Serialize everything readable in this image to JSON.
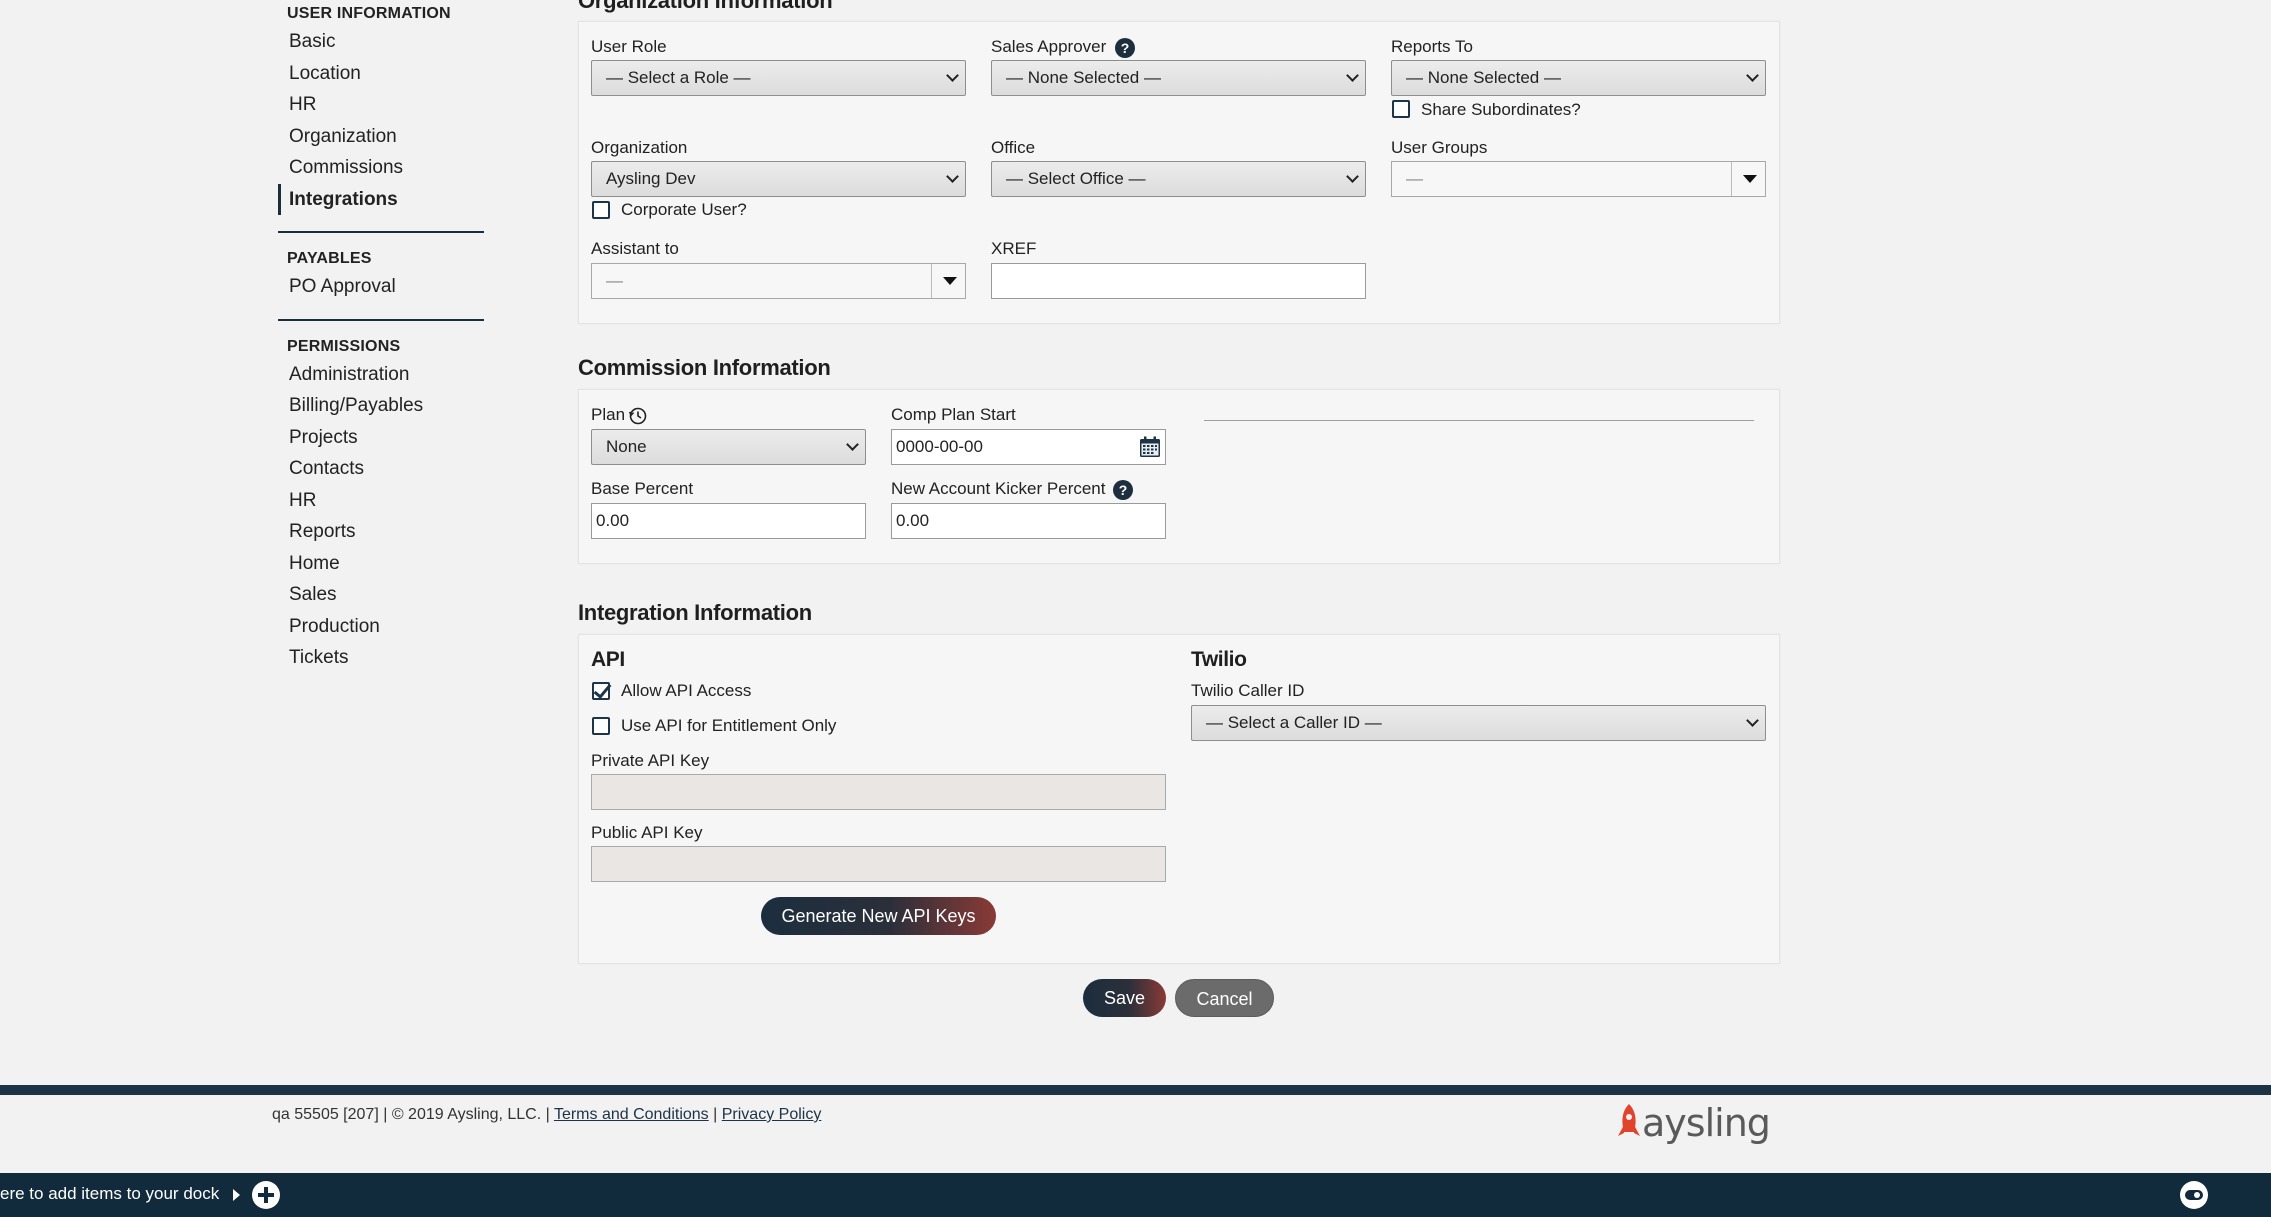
{
  "sidebar": {
    "groups": [
      {
        "title": "USER INFORMATION",
        "items": [
          "Basic",
          "Location",
          "HR",
          "Organization",
          "Commissions",
          "Integrations"
        ]
      },
      {
        "title": "PAYABLES",
        "items": [
          "PO Approval"
        ]
      },
      {
        "title": "PERMISSIONS",
        "items": [
          "Administration",
          "Billing/Payables",
          "Projects",
          "Contacts",
          "HR",
          "Reports",
          "Home",
          "Sales",
          "Production",
          "Tickets"
        ]
      }
    ],
    "active": "Integrations"
  },
  "org": {
    "title": "Organization Information",
    "user_role_label": "User Role",
    "user_role_value": "— Select a Role —",
    "sales_approver_label": "Sales Approver",
    "sales_approver_value": "— None Selected —",
    "reports_to_label": "Reports To",
    "reports_to_value": "— None Selected —",
    "share_subordinates_label": "Share Subordinates?",
    "organization_label": "Organization",
    "organization_value": "Aysling Dev",
    "corporate_user_label": "Corporate User?",
    "office_label": "Office",
    "office_value": "— Select Office —",
    "user_groups_label": "User Groups",
    "user_groups_value": "—",
    "assistant_label": "Assistant to",
    "assistant_value": "—",
    "xref_label": "XREF",
    "xref_value": ""
  },
  "commission": {
    "title": "Commission Information",
    "plan_label": "Plan",
    "plan_value": "None",
    "comp_start_label": "Comp Plan Start",
    "comp_start_value": "0000-00-00",
    "base_percent_label": "Base Percent",
    "base_percent_value": "0.00",
    "kicker_label": "New Account Kicker Percent",
    "kicker_value": "0.00"
  },
  "integration": {
    "title": "Integration Information",
    "api_title": "API",
    "allow_api_label": "Allow API Access",
    "allow_api_checked": true,
    "entitlement_label": "Use API for Entitlement Only",
    "private_key_label": "Private API Key",
    "private_key_value": "",
    "public_key_label": "Public API Key",
    "public_key_value": "",
    "generate_label": "Generate New API Keys",
    "twilio_title": "Twilio",
    "caller_id_label": "Twilio Caller ID",
    "caller_id_value": "— Select a Caller ID —"
  },
  "actions": {
    "save": "Save",
    "cancel": "Cancel"
  },
  "footer": {
    "info": "qa 55505 [207] | © 2019 Aysling, LLC. |",
    "terms": "Terms and Conditions",
    "separator": "|",
    "privacy": "Privacy Policy",
    "logo_text": "aysling"
  },
  "dock": {
    "hint": "ere to add items to your dock"
  },
  "colors": {
    "navy": "#1b3345",
    "accent_red": "#e0442c",
    "gradient_end": "#8a3a36"
  }
}
